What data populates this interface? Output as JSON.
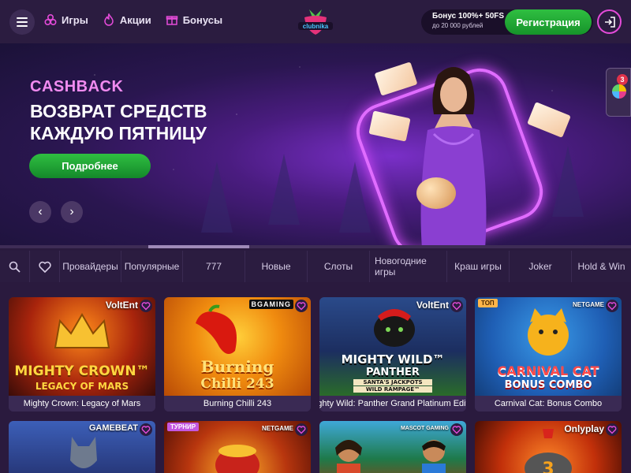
{
  "header": {
    "nav": [
      {
        "label": "Игры",
        "icon": "games-icon"
      },
      {
        "label": "Акции",
        "icon": "flame-icon"
      },
      {
        "label": "Бонусы",
        "icon": "gift-icon"
      }
    ],
    "bonus_line1": "Бонус 100%+ 50FS",
    "bonus_line2": "до 20 000 рублей",
    "register_label": "Регистрация",
    "logo_text": "clubnika"
  },
  "hero": {
    "tag": "CASHBACK",
    "title_line1": "ВОЗВРАТ СРЕДСТВ",
    "title_line2": "КАЖДУЮ ПЯТНИЦУ",
    "button_label": "Подробнее",
    "prev_glyph": "‹",
    "next_glyph": "›",
    "slide_progress": 0.16
  },
  "side_widget": {
    "badge_count": "3"
  },
  "categories": [
    "Провайдеры",
    "Популярные",
    "777",
    "Новые",
    "Слоты",
    "Новогодние игры",
    "Краш игры",
    "Joker",
    "Hold & Win"
  ],
  "games_row1": [
    {
      "name": "Mighty Crown: Legacy of Mars",
      "provider": "VoltEnt",
      "art1": "MIGHTY CROWN™",
      "art2": "LEGACY OF MARS",
      "tag": ""
    },
    {
      "name": "Burning Chilli 243",
      "provider": "BGAMING",
      "art1": "Burning",
      "art2": "Chilli 243",
      "tag": ""
    },
    {
      "name": "Mighty Wild: Panther Grand Platinum Editi...",
      "provider": "VoltEnt",
      "art1": "MIGHTY WILD™",
      "art2": "PANTHER",
      "art3": "SANTA'S JACKPOTS",
      "art4": "WILD RAMPAGE™",
      "tag": ""
    },
    {
      "name": "Carnival Cat: Bonus Combo",
      "provider": "NETGAME",
      "art1": "CARNIVAL CAT",
      "art2": "BONUS COMBO",
      "tag": "ТОП"
    }
  ],
  "games_row2": [
    {
      "provider": "GAMEBEAT",
      "tag": ""
    },
    {
      "provider": "NETGAME",
      "tag": "ТУРНИР"
    },
    {
      "provider": "MASCOT GAMING",
      "tag": ""
    },
    {
      "provider": "Onlyplay",
      "tag": ""
    }
  ],
  "colors": {
    "accent_pink": "#f18bf0",
    "green": "#22a938",
    "bg": "#2a1a3e"
  }
}
